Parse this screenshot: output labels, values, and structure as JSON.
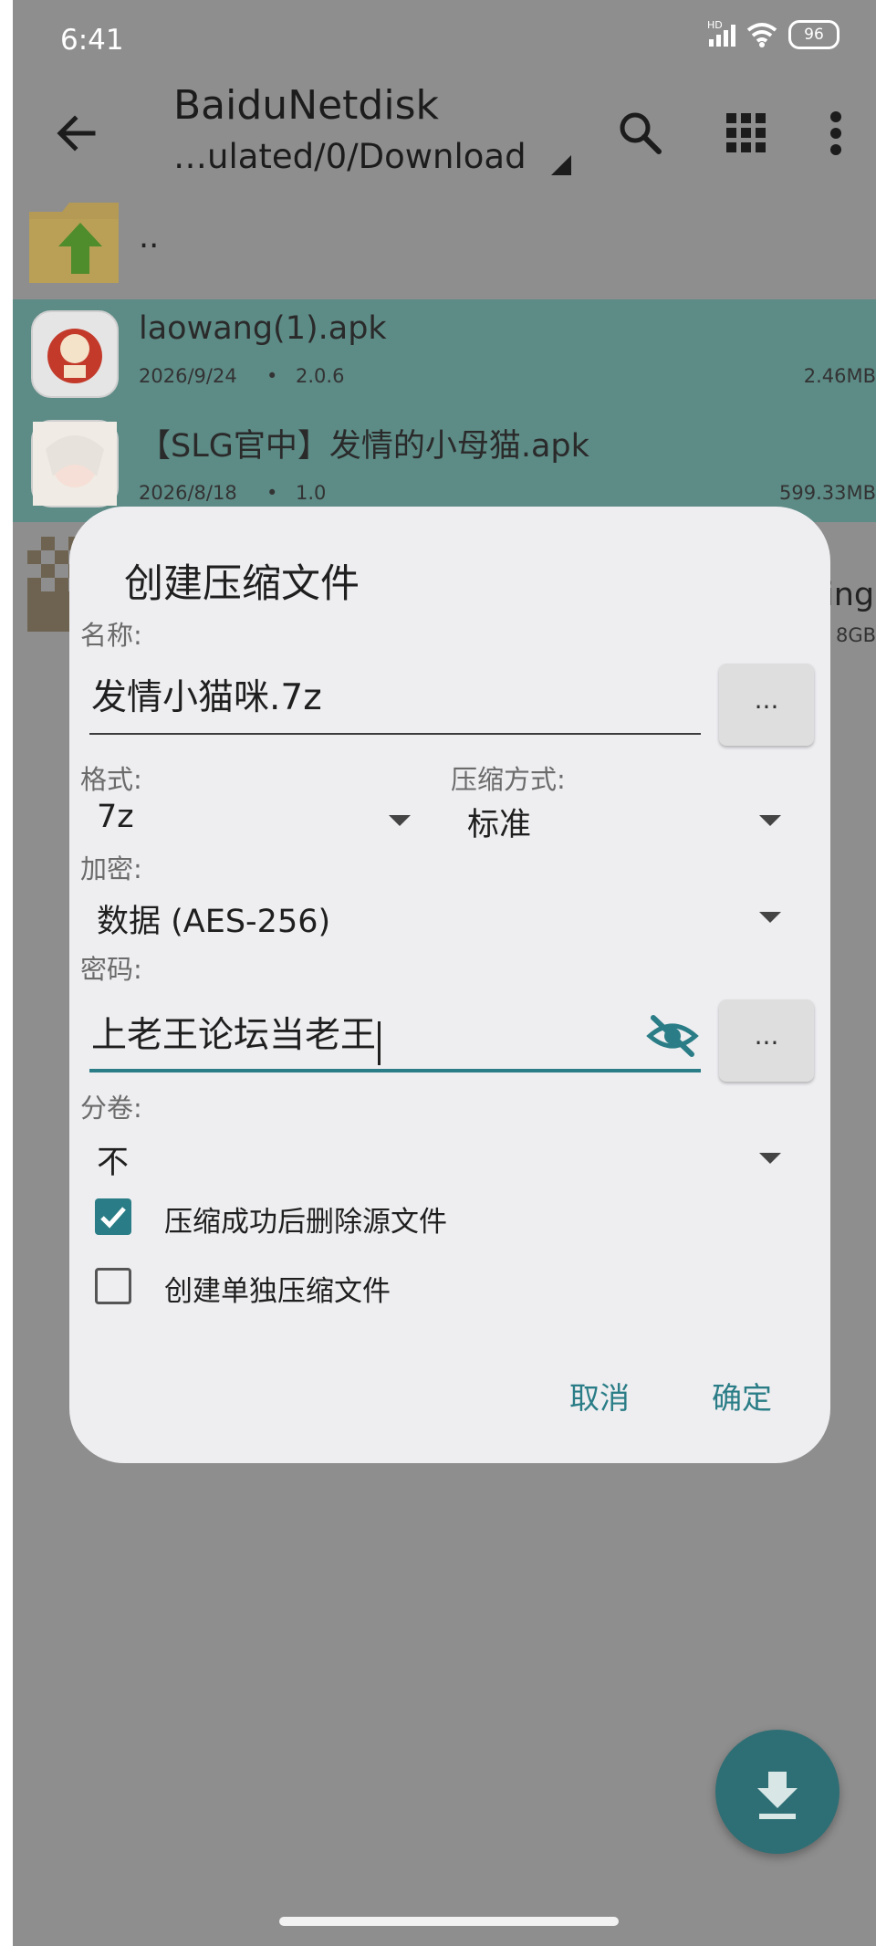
{
  "status": {
    "time": "6:41",
    "signal_tag": "HD",
    "battery": "96"
  },
  "toolbar": {
    "title": "BaiduNetdisk",
    "path": "…ulated/0/Download"
  },
  "files": [
    {
      "name": "..",
      "type": "parent-folder"
    },
    {
      "name": "laowang(1).apk",
      "date": "2026/9/24",
      "version": "2.0.6",
      "size": "2.46MB",
      "selected": true
    },
    {
      "name": "【SLG官中】发情的小母猫.apk",
      "date": "2026/8/18",
      "version": "1.0",
      "size": "599.33MB",
      "selected": true
    },
    {
      "name_fragment": "ing",
      "size_fragment": "8GB"
    }
  ],
  "meta_separator": "•",
  "dialog": {
    "title": "创建压缩文件",
    "name_label": "名称:",
    "name_value": "发情小猫咪.7z",
    "browse_label": "...",
    "format_label": "格式:",
    "format_value": "7z",
    "method_label": "压缩方式:",
    "method_value": "标准",
    "encrypt_label": "加密:",
    "encrypt_value": "数据 (AES-256)",
    "password_label": "密码:",
    "password_value": "上老王论坛当老王",
    "split_label": "分卷:",
    "split_value": "不",
    "delete_source_label": "压缩成功后删除源文件",
    "delete_source_checked": true,
    "separate_label": "创建单独压缩文件",
    "separate_checked": false,
    "cancel_label": "取消",
    "ok_label": "确定"
  },
  "colors": {
    "accent": "#2a7d86",
    "selected_row": "#5d8b86",
    "scrim_background": "#8e8e8e",
    "dialog_background": "#eeeef1"
  }
}
